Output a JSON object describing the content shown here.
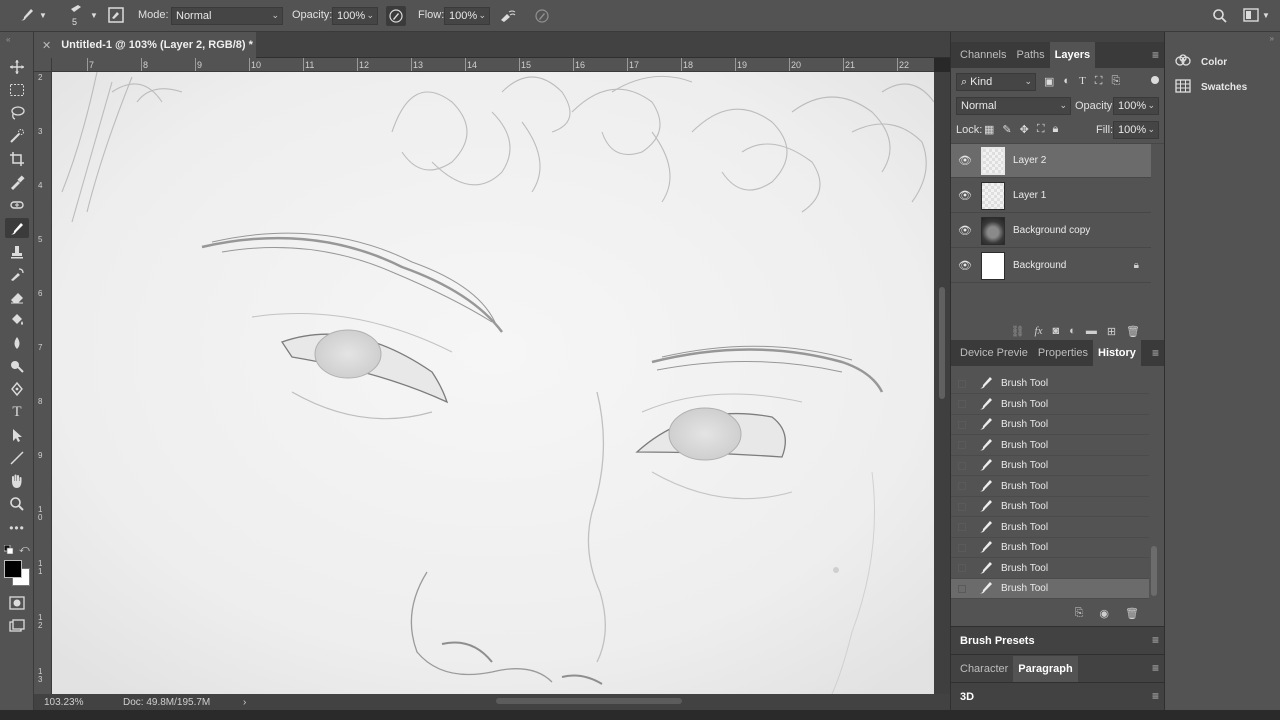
{
  "options_bar": {
    "brush_size": "5",
    "mode_label": "Mode:",
    "mode_value": "Normal",
    "opacity_label": "Opacity:",
    "opacity_value": "100%",
    "flow_label": "Flow:",
    "flow_value": "100%"
  },
  "document": {
    "tab_title": "Untitled-1 @ 103% (Layer 2, RGB/8) *",
    "zoom": "103.23%",
    "doc_info": "Doc: 49.8M/195.7M",
    "ruler_h": [
      "7",
      "8",
      "9",
      "10",
      "11",
      "12",
      "13",
      "14",
      "15",
      "16",
      "17",
      "18",
      "19",
      "20",
      "21",
      "22"
    ],
    "ruler_v": [
      "2",
      "3",
      "4",
      "5",
      "6",
      "7",
      "8",
      "9",
      "1\n0",
      "1\n1",
      "1\n2",
      "1\n3"
    ]
  },
  "layers_panel": {
    "tabs": [
      "Channels",
      "Paths",
      "Layers"
    ],
    "active_tab": "Layers",
    "filter_kind": "Kind",
    "blend_mode": "Normal",
    "opacity_label": "Opacity:",
    "opacity_value": "100%",
    "lock_label": "Lock:",
    "fill_label": "Fill:",
    "fill_value": "100%",
    "layers": [
      {
        "name": "Layer 2",
        "selected": true,
        "visible": true,
        "locked": false,
        "thumb": "transparent"
      },
      {
        "name": "Layer 1",
        "selected": false,
        "visible": true,
        "locked": false,
        "thumb": "transparent"
      },
      {
        "name": "Background copy",
        "selected": false,
        "visible": true,
        "locked": false,
        "thumb": "photo"
      },
      {
        "name": "Background",
        "selected": false,
        "visible": true,
        "locked": true,
        "thumb": "white"
      }
    ]
  },
  "history_panel": {
    "tabs": [
      "Device Previe",
      "Properties",
      "History"
    ],
    "active_tab": "History",
    "items": [
      "Brush Tool",
      "Brush Tool",
      "Brush Tool",
      "Brush Tool",
      "Brush Tool",
      "Brush Tool",
      "Brush Tool",
      "Brush Tool",
      "Brush Tool",
      "Brush Tool",
      "Brush Tool"
    ]
  },
  "collapsed_panels": {
    "brush_presets": "Brush Presets",
    "character": "Character",
    "paragraph": "Paragraph",
    "three_d": "3D"
  },
  "side_panels": {
    "color": "Color",
    "swatches": "Swatches"
  }
}
